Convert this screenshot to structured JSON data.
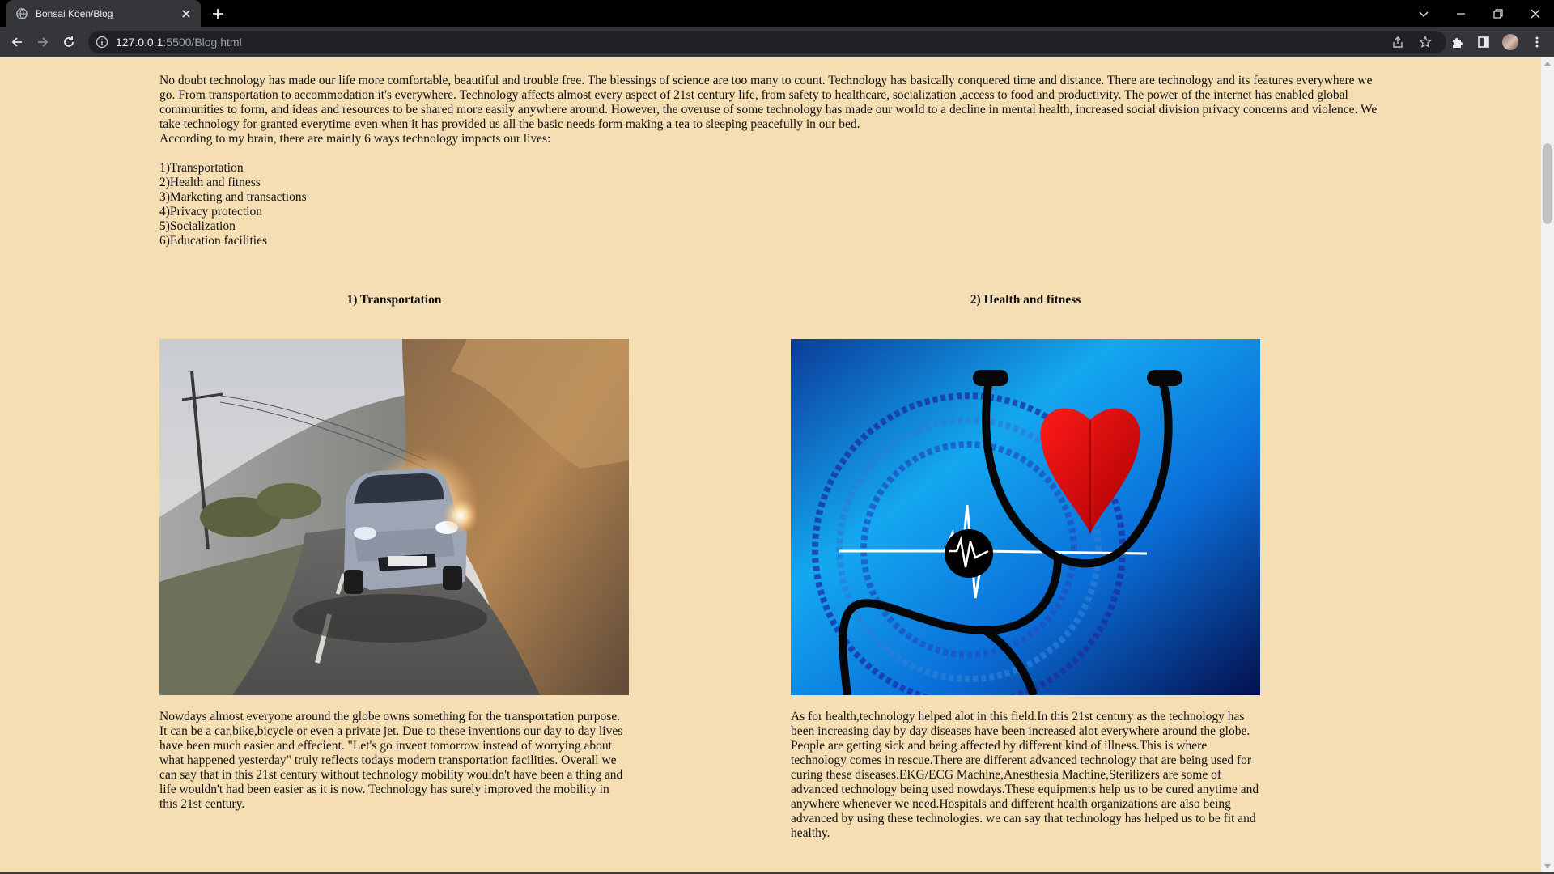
{
  "browser": {
    "tab_title": "Bonsai Kōen/Blog",
    "url_host": "127.0.0.1",
    "url_path": ":5500/Blog.html"
  },
  "intro": {
    "paragraph": "No doubt technology has made our life more comfortable, beautiful and trouble free. The blessings of science are too many to count. Technology has basically conquered time and distance. There are technology and its features everywhere we go. From transportation to accommodation it's everywhere. Technology affects almost every aspect of 21st century life, from safety to healthcare, socialization ,access to food and productivity. The power of the internet has enabled global communities to form, and ideas and resources to be shared more easily anywhere around. However, the overuse of some technology has made our world to a decline in mental health, increased social division privacy concerns and violence. We take technology for granted everytime even when it has provided us all the basic needs form making a tea to sleeping peacefully in our bed.",
    "lead": "According to my brain, there are mainly 6 ways technology impacts our lives:",
    "ways": [
      "1)Transportation",
      "2)Health and fitness",
      "3)Marketing and transactions",
      "4)Privacy protection",
      "5)Socialization",
      "6)Education facilities"
    ]
  },
  "sections": [
    {
      "heading": "1) Transportation",
      "image_alt": "car on road",
      "text": "Nowdays almost everyone around the globe owns something for the transportation purpose. It can be a car,bike,bicycle or even a private jet. Due to these inventions our day to day lives have been much easier and effecient. \"Let's go invent tomorrow instead of worrying about what happened yesterday\" truly reflects todays modern transportation facilities. Overall we can say that in this 21st century without technology mobility wouldn't have been a thing and life wouldn't had been easier as it is now. Technology has surely improved the mobility in this 21st century."
    },
    {
      "heading": "2) Health and fitness",
      "image_alt": "stethoscope heart",
      "text": "As for health,technology helped alot in this field.In this 21st century as the technology has been increasing day by day diseases have been increased alot everywhere around the globe. People are getting sick and being affected by different kind of illness.This is where technology comes in rescue.There are different advanced technology that are being used for curing these diseases.EKG/ECG Machine,Anesthesia Machine,Sterilizers are some of advanced technology being used nowdays.These equipments help us to be cured anytime and anywhere whenever we need.Hospitals and different health organizations are also being advanced by using these technologies. we can say that technology has helped us to be fit and healthy."
    }
  ],
  "colors": {
    "page_background": "#f5deb3",
    "chrome_dark": "#35363a",
    "tabstrip": "#000000"
  }
}
